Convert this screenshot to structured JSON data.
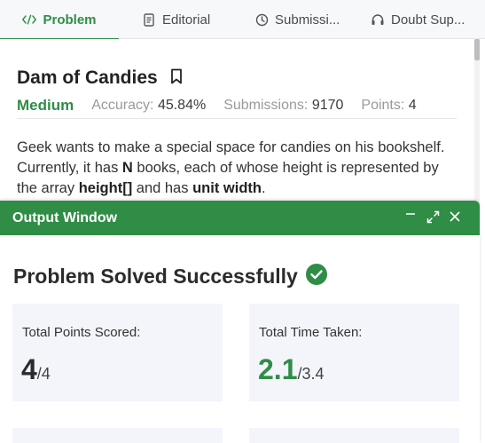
{
  "tabs": [
    {
      "label": "Problem",
      "icon": "code-icon"
    },
    {
      "label": "Editorial",
      "icon": "document-icon"
    },
    {
      "label": "Submissi...",
      "icon": "clock-icon"
    },
    {
      "label": "Doubt Sup...",
      "icon": "headset-icon"
    }
  ],
  "problem": {
    "title": "Dam of Candies",
    "difficulty": "Medium",
    "accuracy_label": "Accuracy:",
    "accuracy_value": "45.84%",
    "submissions_label": "Submissions:",
    "submissions_value": "9170",
    "points_label": "Points:",
    "points_value": "4",
    "desc": {
      "s1": "Geek wants to make a special space for candies on his bookshelf. Currently, it has ",
      "b1": "N",
      "s2": " books, each of whose height is represented by the array ",
      "b2": "height[]",
      "s3": " and has ",
      "b3": "unit width",
      "s4": "."
    }
  },
  "output": {
    "title": "Output Window",
    "status": "Problem Solved Successfully",
    "points_label": "Total Points Scored:",
    "points_scored": "4",
    "points_total": "/4",
    "time_label": "Total Time Taken:",
    "time_taken": "2.1",
    "time_limit": "/3.4"
  },
  "colors": {
    "accent": "#2f8d46",
    "card_bg": "#f3f5fb",
    "tabbar_bg": "#f7f8fa"
  }
}
